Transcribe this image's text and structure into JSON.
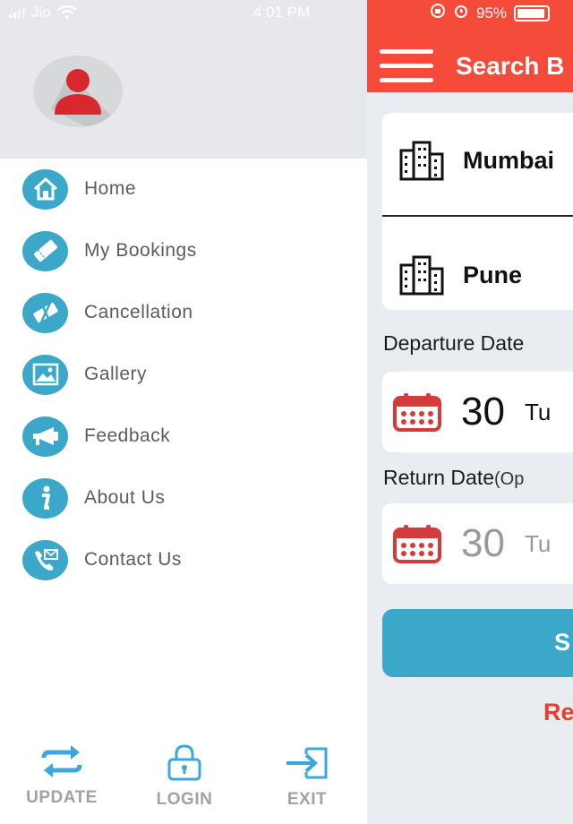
{
  "status": {
    "carrier": "Jio",
    "time": "4:01 PM",
    "battery": "95%"
  },
  "header": {
    "title": "Search B"
  },
  "route": {
    "from": "Mumbai",
    "to": "Pune"
  },
  "departure": {
    "label": "Departure Date",
    "day": "30",
    "rest": "Tu"
  },
  "return": {
    "label": "Return Date",
    "optional": "(Op",
    "day": "30",
    "rest": "Tu"
  },
  "search_button": "S",
  "reset_link": "Re",
  "menu": {
    "items": [
      {
        "label": "Home",
        "icon": "home-icon"
      },
      {
        "label": "My Bookings",
        "icon": "ticket-icon"
      },
      {
        "label": "Cancellation",
        "icon": "cancel-ticket-icon"
      },
      {
        "label": "Gallery",
        "icon": "gallery-icon"
      },
      {
        "label": "Feedback",
        "icon": "megaphone-icon"
      },
      {
        "label": "About Us",
        "icon": "info-icon"
      },
      {
        "label": "Contact Us",
        "icon": "contact-icon"
      }
    ]
  },
  "bottom": {
    "update": "UPDATE",
    "login": "LOGIN",
    "exit": "EXIT"
  },
  "colors": {
    "header": "#f54b3a",
    "accent": "#3ba8c9",
    "bottom_icon": "#3ba8dd"
  }
}
